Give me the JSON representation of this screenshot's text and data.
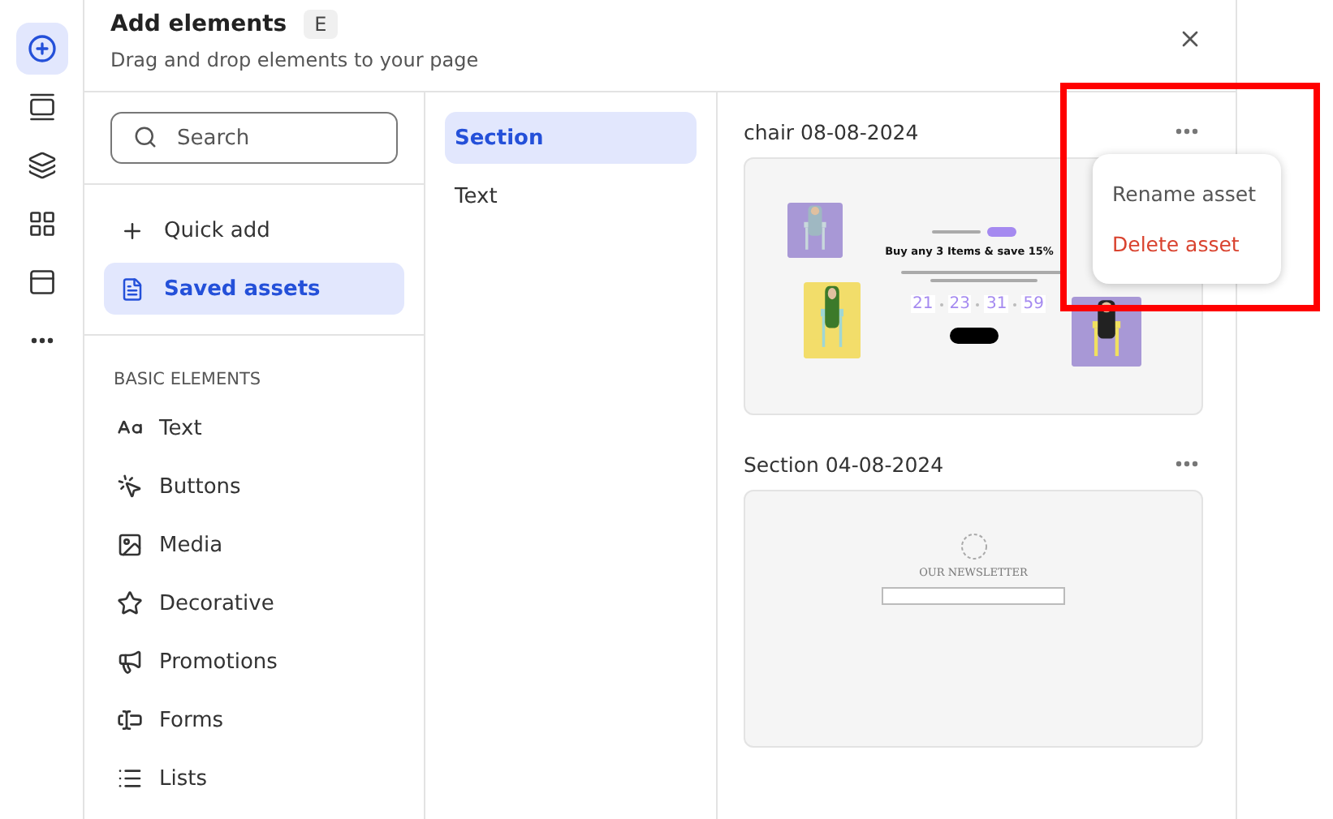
{
  "rail": {
    "items": [
      {
        "kind": "add",
        "selected": true
      },
      {
        "kind": "sections",
        "selected": false
      },
      {
        "kind": "layers",
        "selected": false
      },
      {
        "kind": "apps",
        "selected": false
      },
      {
        "kind": "layout",
        "selected": false
      },
      {
        "kind": "more",
        "selected": false
      }
    ]
  },
  "header": {
    "title": "Add elements",
    "shortcut": "E",
    "subtitle": "Drag and drop elements to your page"
  },
  "search": {
    "placeholder": "Search"
  },
  "nav": [
    {
      "label": "Quick add",
      "kind": "plus",
      "selected": false
    },
    {
      "label": "Saved assets",
      "kind": "saved",
      "selected": true
    }
  ],
  "basic_elements": {
    "heading": "BASIC ELEMENTS",
    "items": [
      {
        "label": "Text",
        "kind": "text"
      },
      {
        "label": "Buttons",
        "kind": "buttons"
      },
      {
        "label": "Media",
        "kind": "media"
      },
      {
        "label": "Decorative",
        "kind": "decorative"
      },
      {
        "label": "Promotions",
        "kind": "promotions"
      },
      {
        "label": "Forms",
        "kind": "forms"
      },
      {
        "label": "Lists",
        "kind": "lists"
      }
    ]
  },
  "categories": [
    {
      "label": "Section",
      "selected": true
    },
    {
      "label": "Text",
      "selected": false
    }
  ],
  "assets": [
    {
      "name": "chair 08-08-2024",
      "kind": "promo",
      "preview": {
        "headline": "Buy any 3 Items & save 15%",
        "countdown": [
          "21",
          "23",
          "31",
          "59"
        ]
      }
    },
    {
      "name": "Section 04-08-2024",
      "kind": "newsletter",
      "preview": {
        "heading": "OUR NEWSLETTER"
      }
    }
  ],
  "menu": {
    "items": [
      {
        "label": "Rename asset",
        "kind": "normal"
      },
      {
        "label": "Delete asset",
        "kind": "danger"
      }
    ]
  },
  "annotation": {
    "kind": "frame"
  }
}
